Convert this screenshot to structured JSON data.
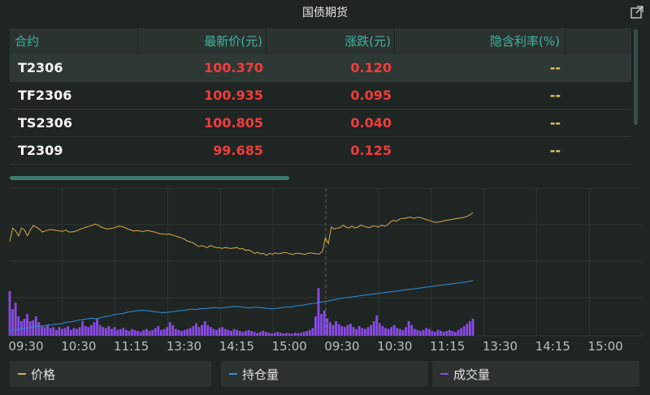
{
  "title": "国债期货",
  "table": {
    "headers": [
      "合约",
      "最新价(元)",
      "涨跌(元)",
      "隐含利率(%)"
    ],
    "rows": [
      {
        "contract": "T2306",
        "price": "100.370",
        "change": "0.120",
        "rate": "--"
      },
      {
        "contract": "TF2306",
        "price": "100.935",
        "change": "0.095",
        "rate": "--"
      },
      {
        "contract": "TS2306",
        "price": "100.805",
        "change": "0.040",
        "rate": "--"
      },
      {
        "contract": "T2309",
        "price": "99.685",
        "change": "0.125",
        "rate": "--"
      }
    ]
  },
  "colors": {
    "price": "#d9a94a",
    "position": "#2f8fd6",
    "volume": "#8a4be6",
    "accent": "#3fb3a0",
    "up": "#f03c3c"
  },
  "chart_data": {
    "type": "line",
    "x_ticks": [
      "09:30",
      "10:30",
      "11:15",
      "13:30",
      "14:15",
      "15:00",
      "09:30",
      "10:30",
      "11:15",
      "13:30",
      "14:15",
      "15:00"
    ],
    "grid": true,
    "series": [
      {
        "name": "价格",
        "values": [
          0.5,
          0.78,
          0.72,
          0.62,
          0.78,
          0.74,
          0.62,
          0.74,
          0.83,
          0.8,
          0.76,
          0.7,
          0.72,
          0.74,
          0.75,
          0.74,
          0.73,
          0.72,
          0.71,
          0.74,
          0.7,
          0.7,
          0.71,
          0.73,
          0.76,
          0.78,
          0.8,
          0.82,
          0.84,
          0.86,
          0.84,
          0.8,
          0.78,
          0.76,
          0.77,
          0.78,
          0.8,
          0.82,
          0.81,
          0.79,
          0.76,
          0.74,
          0.72,
          0.73,
          0.72,
          0.71,
          0.72,
          0.73,
          0.71,
          0.7,
          0.68,
          0.66,
          0.66,
          0.65,
          0.66,
          0.64,
          0.62,
          0.6,
          0.58,
          0.56,
          0.52,
          0.5,
          0.48,
          0.44,
          0.4,
          0.42,
          0.4,
          0.38,
          0.42,
          0.4,
          0.38,
          0.38,
          0.36,
          0.38,
          0.37,
          0.36,
          0.37,
          0.38,
          0.35,
          0.36,
          0.32,
          0.33,
          0.3,
          0.26,
          0.28,
          0.25,
          0.26,
          0.22,
          0.26,
          0.24,
          0.27,
          0.25,
          0.26,
          0.28,
          0.27,
          0.25,
          0.24,
          0.26,
          0.26,
          0.25,
          0.24,
          0.26,
          0.27,
          0.26,
          0.25,
          0.25,
          0.3,
          0.58,
          0.46,
          0.8,
          0.76,
          0.78,
          0.79,
          0.84,
          0.8,
          0.78,
          0.82,
          0.78,
          0.8,
          0.84,
          0.82,
          0.8,
          0.79,
          0.82,
          0.82,
          0.8,
          0.84,
          0.82,
          0.84,
          0.9,
          0.94,
          0.92,
          0.96,
          0.98,
          0.98,
          1.0,
          1.0,
          0.98,
          1.0,
          1.0,
          0.98,
          0.96,
          0.94,
          0.92,
          0.9,
          0.9,
          0.91,
          0.93,
          0.94,
          0.95,
          0.96,
          0.97,
          0.98,
          0.99,
          1.0,
          1.02,
          1.05,
          1.1
        ]
      },
      {
        "name": "持仓量",
        "values": [
          0.0,
          0.05,
          0.06,
          0.1,
          0.12,
          0.14,
          0.15,
          0.18,
          0.22,
          0.25,
          0.24,
          0.26,
          0.28,
          0.32,
          0.3,
          0.35,
          0.34,
          0.36,
          0.4,
          0.44,
          0.46,
          0.48,
          0.52,
          0.55,
          0.58,
          0.6,
          0.62,
          0.65,
          0.64,
          0.62,
          0.66,
          0.7,
          0.74,
          0.76,
          0.8,
          0.84,
          0.86,
          0.88,
          0.9,
          0.94,
          0.98,
          1.0,
          1.02,
          1.05,
          1.06,
          1.05,
          1.04,
          1.02,
          1.0,
          0.98,
          0.96,
          0.94,
          0.95,
          0.96,
          0.98,
          1.0,
          1.02,
          1.04,
          1.06,
          1.08,
          1.1,
          1.12,
          1.1,
          1.12,
          1.14,
          1.15,
          1.16,
          1.18,
          1.2,
          1.19,
          1.17,
          1.18,
          1.2,
          1.22,
          1.24,
          1.26,
          1.25,
          1.24,
          1.22,
          1.2,
          1.18,
          1.2,
          1.22,
          1.21,
          1.2,
          1.18,
          1.16,
          1.15,
          1.14,
          1.16,
          1.18,
          1.2,
          1.22,
          1.24,
          1.22,
          1.26,
          1.28,
          1.3,
          1.32,
          1.35,
          1.38,
          1.4,
          1.42,
          1.45,
          1.48,
          1.5,
          1.52,
          1.55,
          1.58,
          1.62,
          1.65,
          1.68,
          1.7,
          1.72,
          1.74,
          1.76,
          1.78,
          1.8,
          1.82,
          1.84,
          1.86,
          1.88,
          1.9,
          1.92,
          1.94,
          1.96,
          1.98,
          2.0,
          2.02,
          2.04,
          2.06,
          2.08,
          2.1,
          2.12,
          2.14,
          2.16,
          2.18,
          2.2,
          2.22,
          2.24,
          2.26,
          2.28,
          2.3,
          2.32,
          2.34,
          2.36,
          2.38,
          2.4,
          2.42,
          2.44,
          2.46,
          2.48,
          2.5,
          2.52,
          2.55,
          2.6
        ]
      },
      {
        "name": "成交量",
        "values": [
          0.92,
          0.55,
          0.68,
          0.4,
          0.3,
          0.35,
          0.45,
          0.3,
          0.32,
          0.4,
          0.28,
          0.2,
          0.18,
          0.22,
          0.16,
          0.18,
          0.12,
          0.18,
          0.14,
          0.16,
          0.2,
          0.12,
          0.16,
          0.14,
          0.18,
          0.3,
          0.2,
          0.18,
          0.22,
          0.28,
          0.35,
          0.22,
          0.18,
          0.16,
          0.2,
          0.14,
          0.18,
          0.12,
          0.14,
          0.16,
          0.12,
          0.1,
          0.14,
          0.12,
          0.1,
          0.08,
          0.12,
          0.14,
          0.1,
          0.12,
          0.16,
          0.2,
          0.12,
          0.14,
          0.18,
          0.28,
          0.22,
          0.14,
          0.12,
          0.1,
          0.12,
          0.14,
          0.16,
          0.2,
          0.26,
          0.18,
          0.22,
          0.3,
          0.22,
          0.18,
          0.14,
          0.12,
          0.16,
          0.18,
          0.14,
          0.12,
          0.1,
          0.14,
          0.12,
          0.1,
          0.08,
          0.1,
          0.12,
          0.1,
          0.08,
          0.06,
          0.08,
          0.1,
          0.08,
          0.06,
          0.05,
          0.06,
          0.08,
          0.06,
          0.05,
          0.06,
          0.05,
          0.04,
          0.06,
          0.05,
          0.06,
          0.08,
          0.1,
          0.12,
          0.16,
          0.4,
          0.98,
          0.45,
          0.52,
          0.36,
          0.28,
          0.22,
          0.3,
          0.24,
          0.2,
          0.18,
          0.22,
          0.25,
          0.18,
          0.14,
          0.2,
          0.16,
          0.14,
          0.18,
          0.22,
          0.3,
          0.42,
          0.26,
          0.2,
          0.16,
          0.14,
          0.18,
          0.22,
          0.16,
          0.14,
          0.12,
          0.18,
          0.3,
          0.22,
          0.14,
          0.12,
          0.1,
          0.12,
          0.16,
          0.14,
          0.1,
          0.08,
          0.12,
          0.1,
          0.08,
          0.1,
          0.12,
          0.1,
          0.08,
          0.12,
          0.16,
          0.2,
          0.25,
          0.3,
          0.35
        ]
      }
    ]
  },
  "legend": [
    "价格",
    "持仓量",
    "成交量"
  ]
}
